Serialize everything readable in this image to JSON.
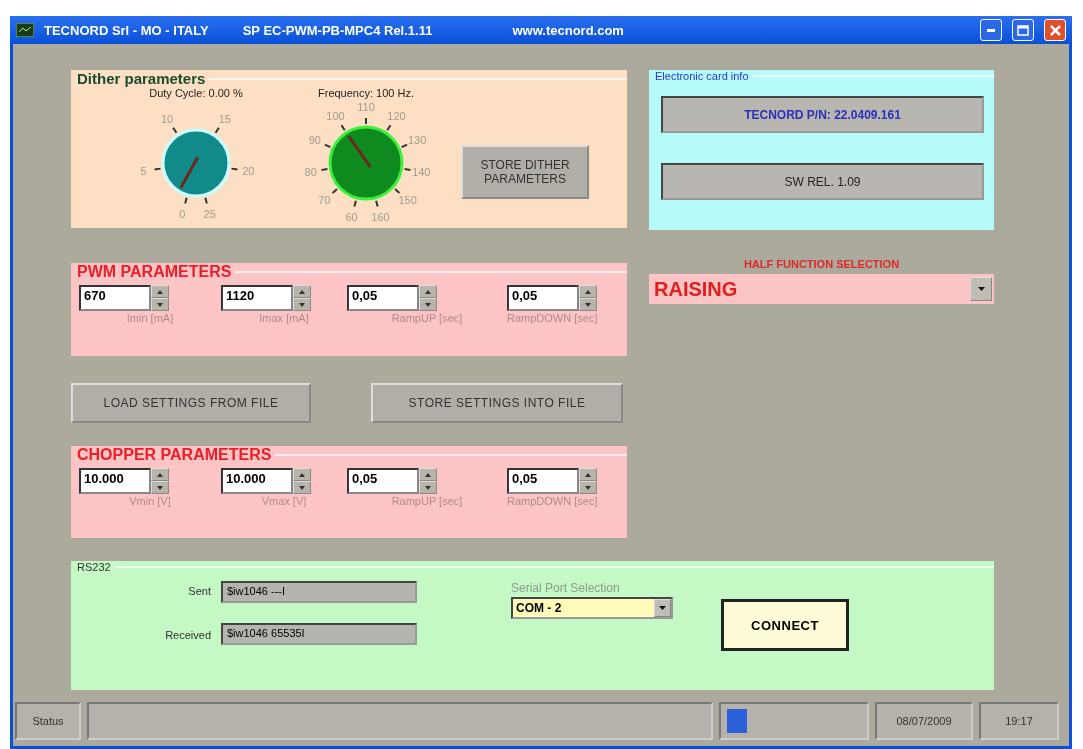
{
  "window": {
    "title_parts": [
      "TECNORD Srl -  MO - ITALY",
      "SP EC-PWM-PB-MPC4 Rel.1.11",
      "www.tecnord.com"
    ]
  },
  "dither": {
    "title": "Dither parameters",
    "knobs": [
      {
        "caption": "Duty Cycle: 0.00 %",
        "color": "#138a8a",
        "ticks": [
          "0",
          "5",
          "10",
          "15",
          "20",
          "25"
        ]
      },
      {
        "caption": "Frequency: 100 Hz.",
        "color": "#0e8a1e",
        "ticks": [
          "60",
          "70",
          "80",
          "90",
          "100",
          "110",
          "120",
          "130",
          "140",
          "150",
          "160"
        ]
      }
    ],
    "button": "STORE DITHER PARAMETERS"
  },
  "card_info": {
    "title": "Electronic card info",
    "part_number": "TECNORD P/N: 22.0409.161",
    "sw_release": "SW REL. 1.09"
  },
  "half_function": {
    "label": "HALF FUNCTION SELECTION",
    "value": "RAISING"
  },
  "pwm": {
    "title": "PWM PARAMETERS",
    "fields": [
      {
        "value": "670",
        "label": "Imin [mA]"
      },
      {
        "value": "1120",
        "label": "Imax [mA]"
      },
      {
        "value": "0,05",
        "label": "RampUP [sec]"
      },
      {
        "value": "0,05",
        "label": "RampDOWN [sec]"
      }
    ]
  },
  "file_buttons": [
    "LOAD SETTINGS FROM FILE",
    "STORE SETTINGS INTO FILE"
  ],
  "chopper": {
    "title": "CHOPPER PARAMETERS",
    "fields": [
      {
        "value": "10.000",
        "label": "Vmin [V]"
      },
      {
        "value": "10.000",
        "label": "Vmax [V]"
      },
      {
        "value": "0,05",
        "label": "RampUP [sec]"
      },
      {
        "value": "0,05",
        "label": "RampDOWN [sec]"
      }
    ]
  },
  "rs232": {
    "title": "RS232",
    "sent_label": "Sent",
    "sent": "$iw1046 ---I",
    "received_label": "Received",
    "received": "$iw1046 65535I",
    "port_label": "Serial Port Selection",
    "port": "COM - 2",
    "connect": "CONNECT"
  },
  "status_bar": {
    "label": "Status",
    "progress": {
      "level": 0.15
    },
    "date": "08/07/2009",
    "time": "19:17"
  }
}
